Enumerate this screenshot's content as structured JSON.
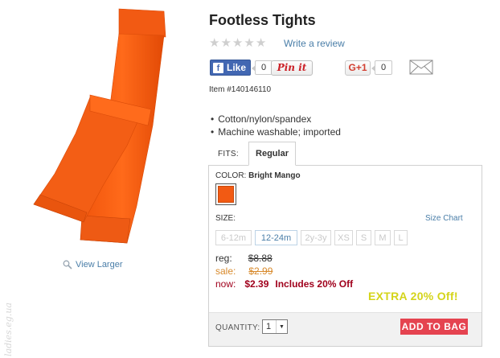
{
  "product": {
    "title": "Footless Tights",
    "item_number": "Item #140146110",
    "features": [
      "Cotton/nylon/spandex",
      "Machine washable; imported"
    ],
    "image_icon": "orange-tights-image",
    "view_larger": "View Larger",
    "watermark": "ladies.eg.ua"
  },
  "reviews": {
    "rating": 0,
    "max_rating": 5,
    "write_review": "Write a review"
  },
  "social": {
    "like_label": "Like",
    "like_count": "0",
    "pin_label": "Pin it",
    "pin_count": "0",
    "gplus_label": "G+1",
    "gplus_count": "0",
    "share_icon": "envelope-icon"
  },
  "tabs": {
    "fits_label": "FITS:",
    "items": [
      "Regular"
    ]
  },
  "options": {
    "color_label": "COLOR:",
    "color_name": "Bright Mango",
    "swatch_color": "#f25a13",
    "size_label": "SIZE:",
    "size_chart": "Size Chart",
    "sizes": [
      {
        "label": "6-12m",
        "state": "unavailable"
      },
      {
        "label": "12-24m",
        "state": "available"
      },
      {
        "label": "2y-3y",
        "state": "unavailable"
      },
      {
        "label": "XS",
        "state": "unavailable"
      },
      {
        "label": "S",
        "state": "unavailable"
      },
      {
        "label": "M",
        "state": "unavailable"
      },
      {
        "label": "L",
        "state": "unavailable"
      }
    ]
  },
  "pricing": {
    "reg_label": "reg:",
    "reg_price": "$8.88",
    "sale_label": "sale:",
    "sale_price": "$2.99",
    "now_label": "now:",
    "now_price": "$2.39",
    "includes": "Includes 20% Off",
    "extra": "EXTRA 20% Off!"
  },
  "cart": {
    "quantity_label": "QUANTITY:",
    "quantity_value": "1",
    "add_button": "ADD TO BAG"
  },
  "colors": {
    "link": "#4a7ea8",
    "now_price": "#a0001c",
    "sale_price": "#d88a2c",
    "extra": "#d4d41a",
    "add_button": "#e54350"
  }
}
